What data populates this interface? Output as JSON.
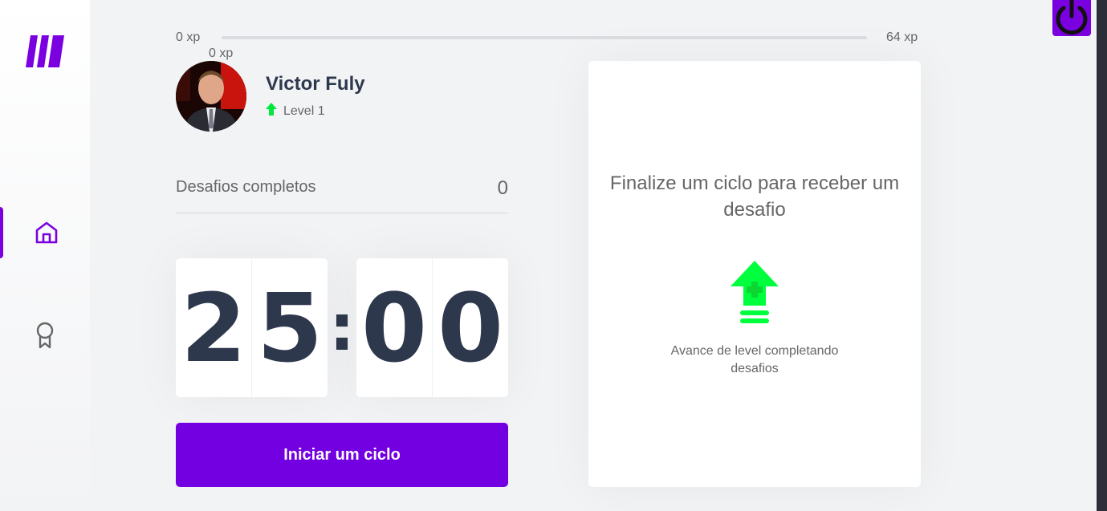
{
  "app": {
    "brand_color": "#7a00e0",
    "accent_green": "#00ff3c"
  },
  "sidebar": {
    "logo": "moveit-logo",
    "items": [
      {
        "icon": "home-icon",
        "active": true
      },
      {
        "icon": "award-icon",
        "active": false
      }
    ]
  },
  "header": {
    "power_icon": "power-icon"
  },
  "experience": {
    "min_label": "0 xp",
    "max_label": "64 xp",
    "current_label": "0 xp",
    "progress_fraction": 0
  },
  "profile": {
    "name": "Victor Fuly",
    "level_label": "Level 1"
  },
  "completed_challenges": {
    "label": "Desafios completos",
    "count": "0"
  },
  "countdown": {
    "minute_left": "2",
    "minute_right": "5",
    "separator": ":",
    "second_left": "0",
    "second_right": "0"
  },
  "start_button": {
    "label": "Iniciar um ciclo"
  },
  "challenge_box": {
    "title": "Finalize um ciclo para receber um desafio",
    "hint": "Avance de level completando desafios",
    "icon": "level-up-icon"
  }
}
